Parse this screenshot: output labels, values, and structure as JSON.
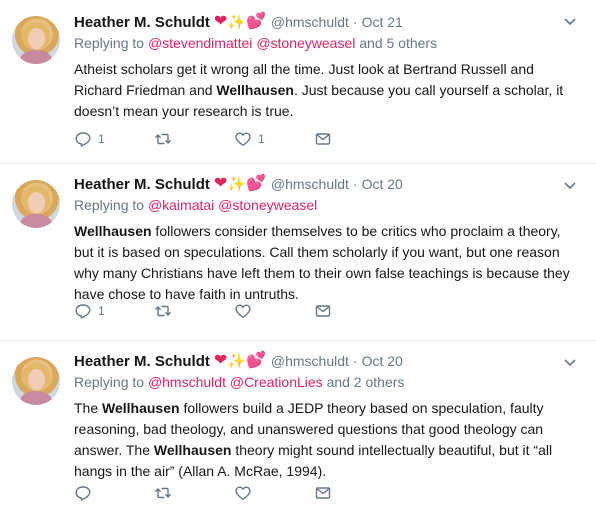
{
  "tweets": [
    {
      "name": "Heather M. Schuldt",
      "handle": "@hmschuldt",
      "time": "Oct 21",
      "reply_prefix": "Replying to",
      "mentions": [
        "@stevendimattei",
        "@stoneyweasel"
      ],
      "reply_suffix": "and 5 others",
      "segments": [
        {
          "text": "Atheist scholars get it wrong all the time. Just look at Bertrand Russell and Richard Friedman and ",
          "bold": false
        },
        {
          "text": "Wellhausen",
          "bold": true
        },
        {
          "text": ". Just because you call yourself a scholar, it doesn’t mean your research is true.",
          "bold": false
        }
      ],
      "reply_count": "1",
      "retweet_count": "",
      "like_count": "1"
    },
    {
      "name": "Heather M. Schuldt",
      "handle": "@hmschuldt",
      "time": "Oct 20",
      "reply_prefix": "Replying to",
      "mentions": [
        "@kaimatai",
        "@stoneyweasel"
      ],
      "reply_suffix": "",
      "segments": [
        {
          "text": "Wellhausen",
          "bold": true
        },
        {
          "text": " followers consider themselves to be critics who proclaim a theory, but it is based on speculations. Call them scholarly if you want, but one reason why many Christians have left them to their own false teachings is because they have chose to have faith in untruths.",
          "bold": false
        }
      ],
      "reply_count": "1",
      "retweet_count": "",
      "like_count": ""
    },
    {
      "name": "Heather M. Schuldt",
      "handle": "@hmschuldt",
      "time": "Oct 20",
      "reply_prefix": "Replying to",
      "mentions": [
        "@hmschuldt",
        "@CreationLies"
      ],
      "reply_suffix": "and 2 others",
      "segments": [
        {
          "text": "The ",
          "bold": false
        },
        {
          "text": "Wellhausen",
          "bold": true
        },
        {
          "text": " followers build a JEDP theory based on speculation, faulty reasoning, bad theology, and unanswered questions that good theology can answer. The ",
          "bold": false
        },
        {
          "text": "Wellhausen",
          "bold": true
        },
        {
          "text": " theory might sound intellectually beautiful, but it “all hangs in the air” (Allan A. McRae, 1994).",
          "bold": false
        }
      ],
      "reply_count": "",
      "retweet_count": "",
      "like_count": ""
    }
  ],
  "separator": "·",
  "colors": {
    "mention": "#e0245e",
    "secondary_text": "#657786",
    "primary_text": "#14171a",
    "heart": "#e0245e",
    "sparkle": "#ffac33",
    "divider": "#e6ecf0"
  },
  "icons": {
    "reply": "reply-icon",
    "retweet": "retweet-icon",
    "like": "like-icon",
    "message": "direct-message-icon",
    "caret": "chevron-down-icon",
    "emoji": [
      "red-heart-emoji",
      "sparkles-emoji",
      "two-hearts-emoji"
    ]
  }
}
